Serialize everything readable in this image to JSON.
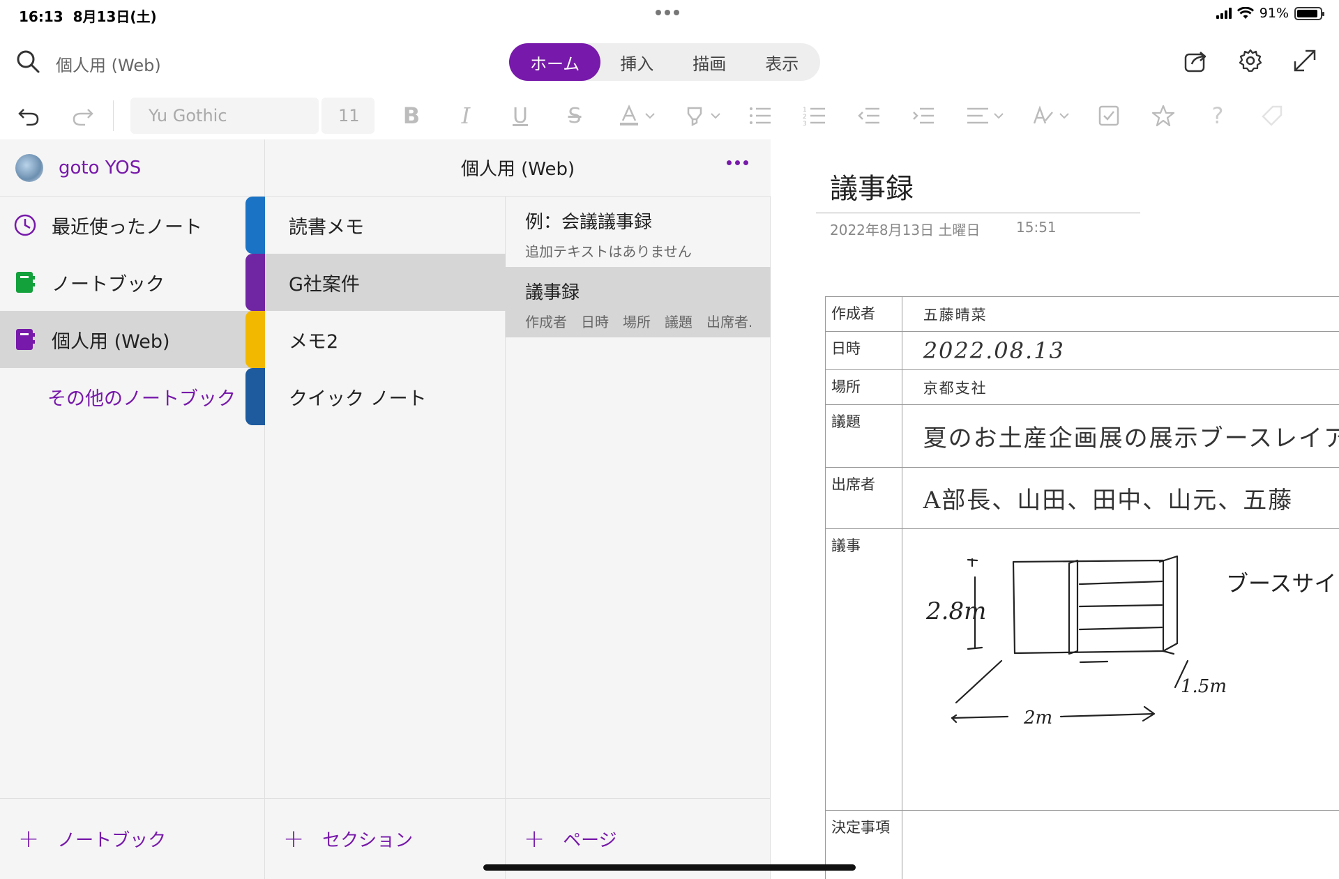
{
  "status": {
    "time": "16:13",
    "date": "8月13日(土)",
    "battery": "91%"
  },
  "topbar": {
    "search_label": "個人用 (Web)"
  },
  "tabs": [
    {
      "label": "ホーム",
      "active": true
    },
    {
      "label": "挿入",
      "active": false
    },
    {
      "label": "描画",
      "active": false
    },
    {
      "label": "表示",
      "active": false
    }
  ],
  "toolbar": {
    "font_name": "Yu Gothic",
    "font_size": "11"
  },
  "notebooks_pane": {
    "user": "goto YOS",
    "items": [
      {
        "label": "最近使ったノート",
        "icon": "clock-icon"
      },
      {
        "label": "ノートブック",
        "icon": "notebook-green-icon"
      },
      {
        "label": "個人用 (Web)",
        "icon": "notebook-purple-icon",
        "selected": true
      },
      {
        "label": "その他のノートブック",
        "icon": ""
      }
    ],
    "add_label": "ノートブック"
  },
  "sections_pane": {
    "header": "個人用 (Web)",
    "items": [
      {
        "label": "読書メモ",
        "color": "#1a73c4"
      },
      {
        "label": "G社案件",
        "color": "#7026a2",
        "selected": true
      },
      {
        "label": "メモ2",
        "color": "#f2b800"
      },
      {
        "label": "クイック ノート",
        "color": "#1d5a9e"
      }
    ],
    "add_label": "セクション"
  },
  "pages_pane": {
    "items": [
      {
        "title": "例：会議議事録",
        "subtitle": "追加テキストはありません"
      },
      {
        "title": "議事録",
        "subtitle": "作成者　日時　場所　議題　出席者...",
        "selected": true
      }
    ],
    "add_label": "ページ"
  },
  "note": {
    "title": "議事録",
    "date": "2022年8月13日 土曜日",
    "time": "15:51",
    "rows": [
      {
        "label": "作成者",
        "handwriting": "五藤晴菜"
      },
      {
        "label": "日時",
        "handwriting": "2022.08.13"
      },
      {
        "label": "場所",
        "handwriting": "京都支社"
      },
      {
        "label": "議題",
        "handwriting": "夏のお土産企画展の展示ブースレイア"
      },
      {
        "label": "出席者",
        "handwriting": "A部長、山田、田中、山元、五藤"
      },
      {
        "label": "議事",
        "handwriting": ""
      },
      {
        "label": "決定事項",
        "handwriting": ""
      }
    ],
    "sketch_labels": {
      "height": "2.8m",
      "depth": "1.5m",
      "width": "2m",
      "caption": "ブースサイ"
    }
  }
}
